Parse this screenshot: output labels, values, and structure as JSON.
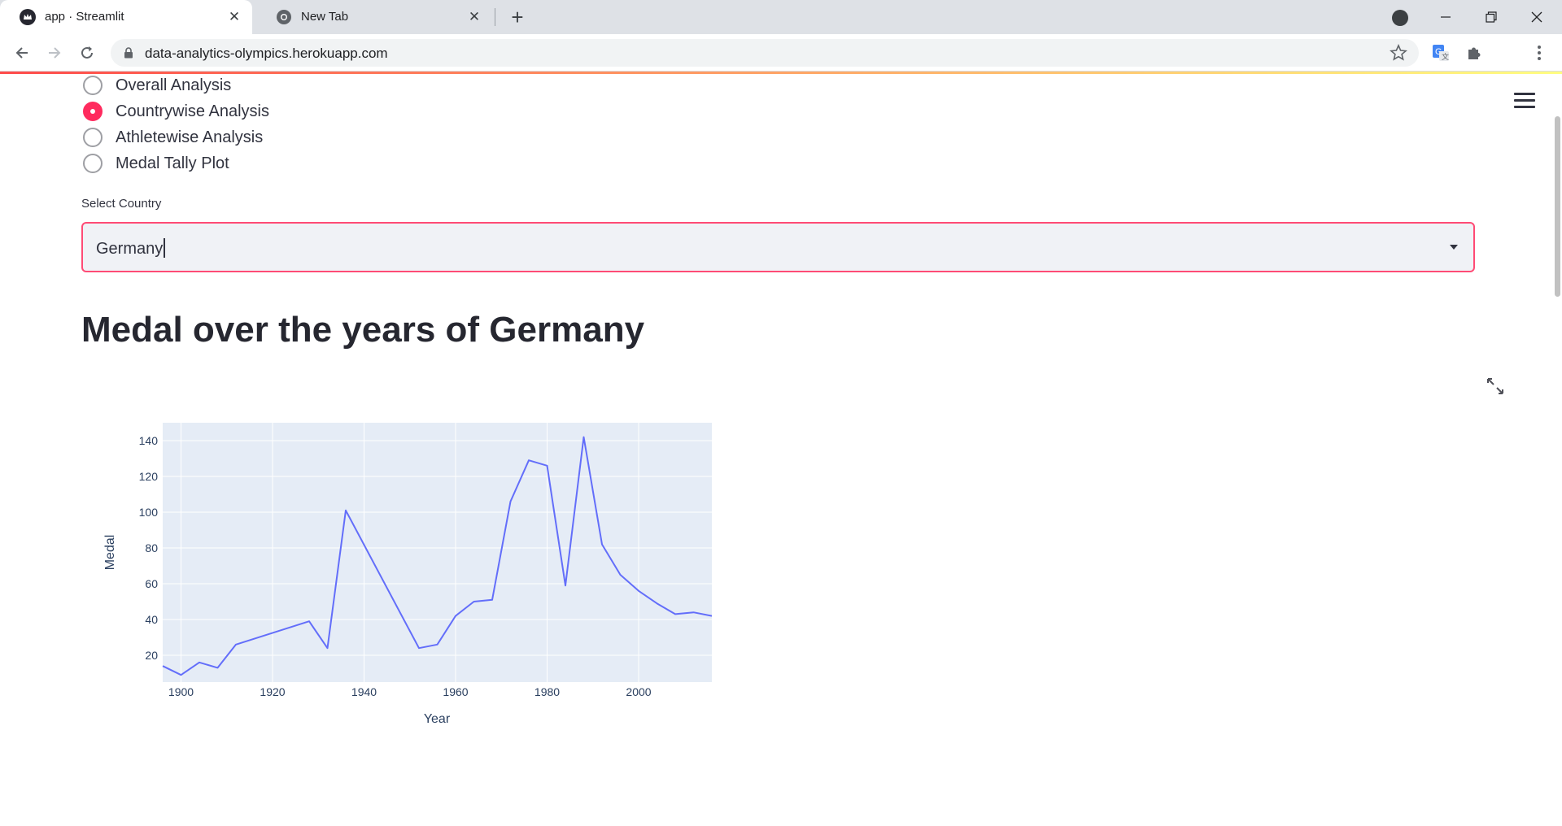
{
  "browser": {
    "tabs": [
      {
        "title": "app · Streamlit",
        "favicon": "streamlit-crown-icon"
      },
      {
        "title": "New Tab",
        "favicon": "chrome-icon"
      }
    ],
    "new_tab_glyph": "+",
    "url": "data-analytics-olympics.herokuapp.com"
  },
  "sidebar_radio": {
    "options": [
      "Overall Analysis",
      "Countrywise Analysis",
      "Athletewise Analysis",
      "Medal Tally Plot"
    ],
    "selected": "Countrywise Analysis"
  },
  "country_select": {
    "label": "Select Country",
    "value": "Germany"
  },
  "main": {
    "title": "Medal over the years of Germany"
  },
  "colors": {
    "accent": "#ff2b5e",
    "line": "#636efa",
    "plot_bg": "#e5ecf6"
  },
  "chart_data": {
    "type": "line",
    "title": "",
    "xlabel": "Year",
    "ylabel": "Medal",
    "xlim": [
      1896,
      2016
    ],
    "ylim": [
      5,
      150
    ],
    "x_ticks": [
      "1900",
      "1920",
      "1940",
      "1960",
      "1980",
      "2000"
    ],
    "y_ticks": [
      "20",
      "40",
      "60",
      "80",
      "100",
      "120",
      "140"
    ],
    "grid": true,
    "series": [
      {
        "x": [
          1896,
          1900,
          1904,
          1908,
          1912,
          1928,
          1932,
          1936,
          1952,
          1956,
          1960,
          1964,
          1968,
          1972,
          1976,
          1980,
          1984,
          1988,
          1992,
          1996,
          2000,
          2004,
          2008,
          2012,
          2016
        ],
        "values": [
          14,
          9,
          16,
          13,
          26,
          39,
          24,
          101,
          24,
          26,
          42,
          50,
          51,
          106,
          129,
          126,
          59,
          142,
          82,
          65,
          56,
          49,
          43,
          44,
          42
        ]
      }
    ]
  }
}
